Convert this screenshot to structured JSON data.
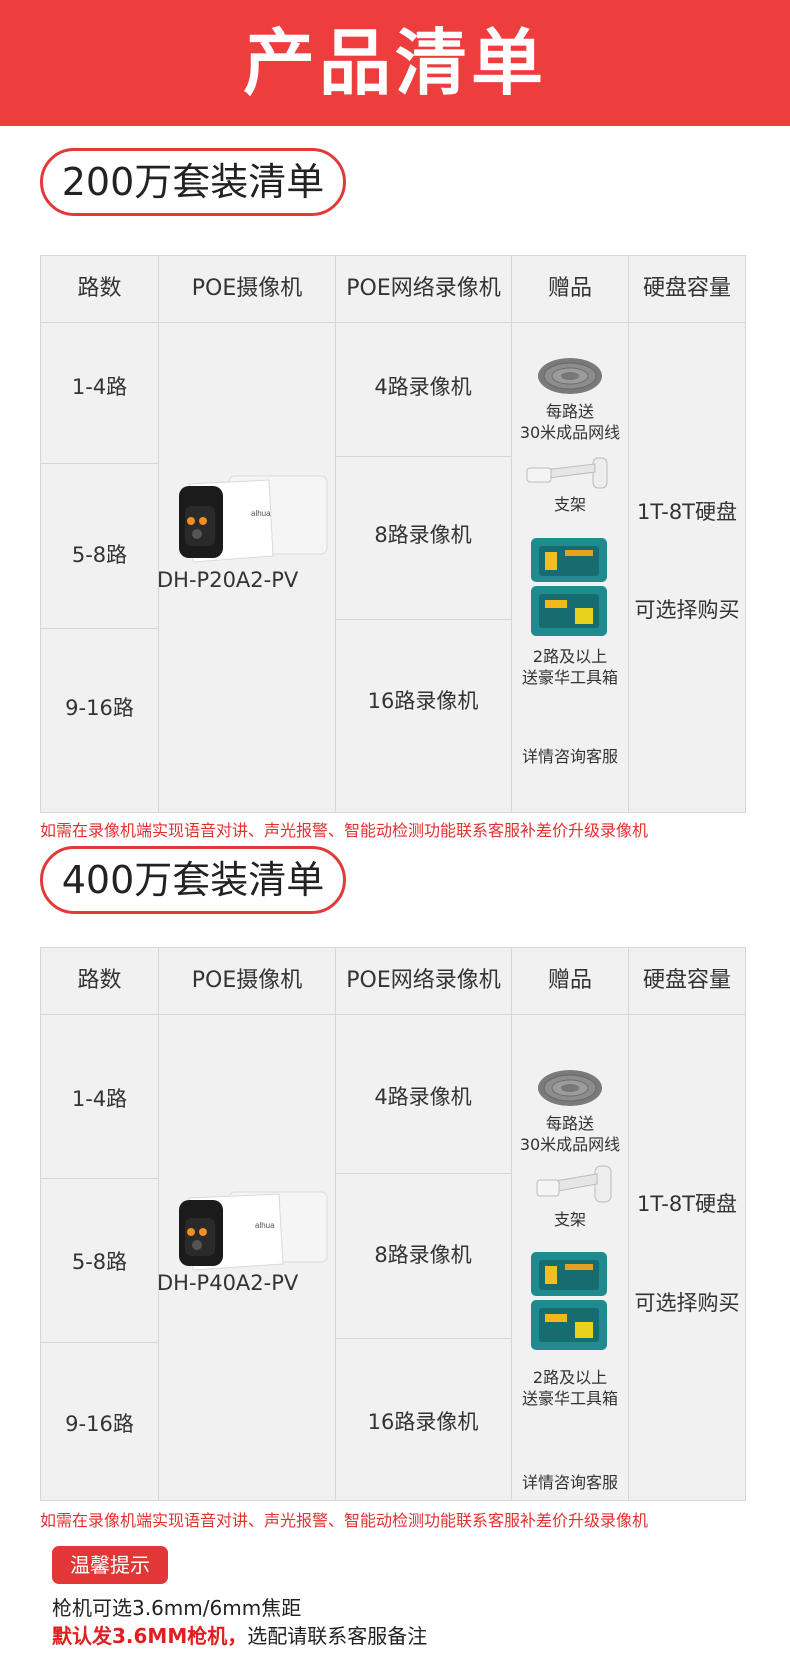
{
  "header": {
    "title": "产品清单"
  },
  "packages": [
    {
      "title": "200万套装清单",
      "columns": [
        "路数",
        "POE摄像机",
        "POE网络录像机",
        "赠品",
        "硬盘容量"
      ],
      "rows": [
        "1-4路",
        "5-8路",
        "9-16路"
      ],
      "camera_model": "DH-P20A2-PV",
      "nvr": [
        "4路录像机",
        "8路录像机",
        "16路录像机"
      ],
      "gifts": {
        "cable_line1": "每路送",
        "cable_line2": "30米成品网线",
        "bracket": "支架",
        "toolbox_line1": "2路及以上",
        "toolbox_line2": "送豪华工具箱",
        "consult": "详情咨询客服"
      },
      "disk_capacity": "1T-8T硬盘",
      "disk_optional": "可选择购买",
      "note": "如需在录像机端实现语音对讲、声光报警、智能动检测功能联系客服补差价升级录像机"
    },
    {
      "title": "400万套装清单",
      "columns": [
        "路数",
        "POE摄像机",
        "POE网络录像机",
        "赠品",
        "硬盘容量"
      ],
      "rows": [
        "1-4路",
        "5-8路",
        "9-16路"
      ],
      "camera_model": "DH-P40A2-PV",
      "nvr": [
        "4路录像机",
        "8路录像机",
        "16路录像机"
      ],
      "gifts": {
        "cable_line1": "每路送",
        "cable_line2": "30米成品网线",
        "bracket": "支架",
        "toolbox_line1": "2路及以上",
        "toolbox_line2": "送豪华工具箱",
        "consult": "详情咨询客服"
      },
      "disk_capacity": "1T-8T硬盘",
      "disk_optional": "可选择购买",
      "note": "如需在录像机端实现语音对讲、声光报警、智能动检测功能联系客服补差价升级录像机"
    }
  ],
  "tips": {
    "badge": "温馨提示",
    "line1": "枪机可选3.6mm/6mm焦距",
    "line2_bold": "默认发3.6MM枪机，",
    "line2_rest": "选配请联系客服备注"
  },
  "colors": {
    "accent": "#ee3d3d",
    "table_bg": "#f1f1f1",
    "note_red": "#e23131"
  },
  "icons": [
    "network-cable-icon",
    "bracket-icon",
    "toolbox-icon",
    "camera-image"
  ]
}
